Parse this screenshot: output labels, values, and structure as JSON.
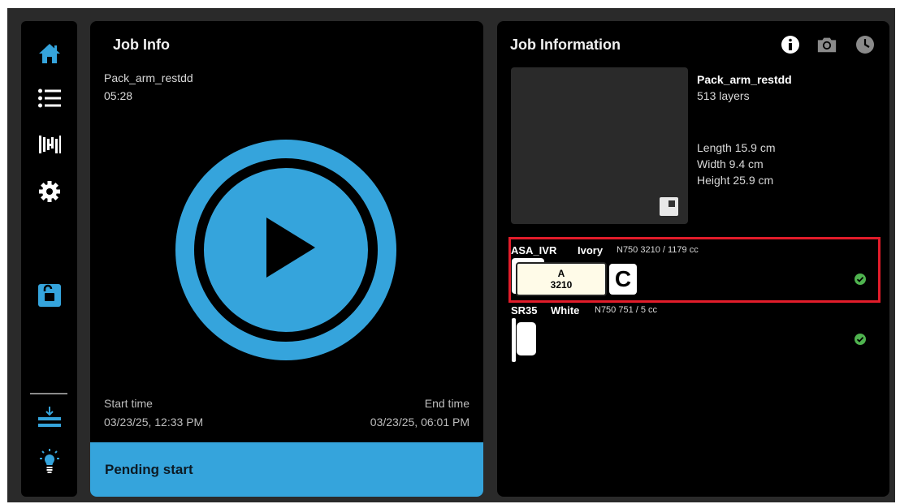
{
  "sidebar": {
    "items": [
      {
        "name": "home",
        "icon": "home-icon",
        "active": true
      },
      {
        "name": "list",
        "icon": "list-icon"
      },
      {
        "name": "materials",
        "icon": "materials-icon"
      },
      {
        "name": "settings",
        "icon": "gear-icon"
      },
      {
        "name": "lock",
        "icon": "unlock-icon"
      },
      {
        "name": "download",
        "icon": "download-tray-icon"
      },
      {
        "name": "light",
        "icon": "lightbulb-icon"
      }
    ],
    "accent": "#35a4dc"
  },
  "left_panel": {
    "title": "Job Info",
    "job_name": "Pack_arm_restdd",
    "duration": "05:28",
    "start_label": "Start time",
    "start_value": "03/23/25, 12:33 PM",
    "end_label": "End time",
    "end_value": "03/23/25, 06:01 PM",
    "status": "Pending start",
    "play_color": "#35a4dc"
  },
  "right_panel": {
    "title": "Job Information",
    "header_icons": [
      "info-icon",
      "camera-icon",
      "clock-icon"
    ],
    "job_name": "Pack_arm_restdd",
    "layers": "513 layers",
    "length": "Length 15.9 cm",
    "width": "Width 9.4 cm",
    "height": "Height 25.9 cm",
    "materials": [
      {
        "code": "ASA_IVR",
        "color": "Ivory",
        "info": "N750 3210 / 1179 cc",
        "slot": "A",
        "slot_num": "3210",
        "badge": "C",
        "highlighted": true,
        "status": "ok"
      },
      {
        "code": "SR35",
        "color": "White",
        "info": "N750 751 / 5 cc",
        "status": "ok"
      }
    ],
    "highlight_color": "#e21c2a",
    "ok_color": "#4fb34f"
  }
}
